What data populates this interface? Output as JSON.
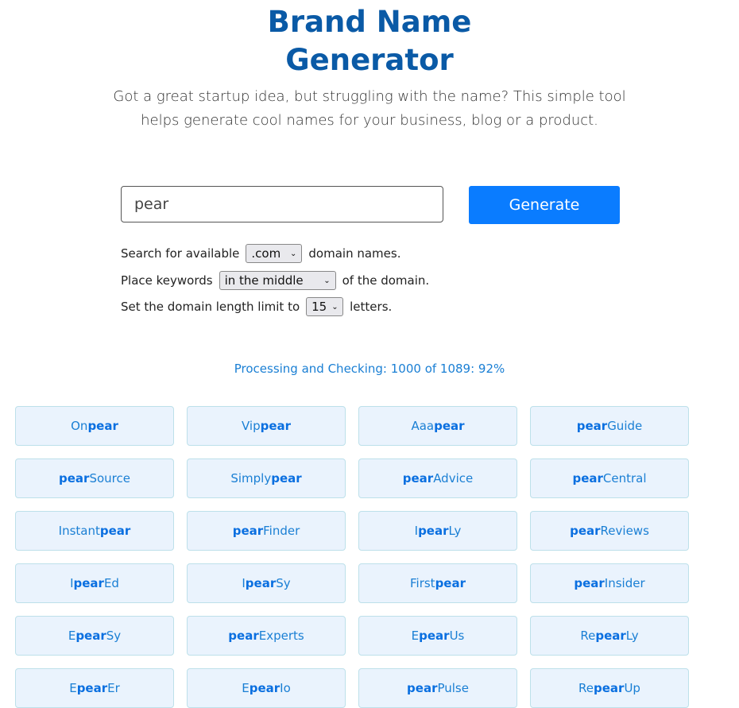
{
  "header": {
    "title_line1": "Brand Name",
    "title_line2": "Generator",
    "subtitle": "Got a great startup idea, but struggling with the name? This simple tool helps generate cool names for your business, blog or a product."
  },
  "form": {
    "keyword_value": "pear",
    "generate_label": "Generate",
    "tld_prefix": "Search for available",
    "tld_value": ".com",
    "tld_suffix": "domain names.",
    "place_prefix": "Place keywords",
    "place_value": "in the middle",
    "place_suffix": "of the domain.",
    "length_prefix": "Set the domain length limit to",
    "length_value": "15",
    "length_suffix": "letters."
  },
  "progress": {
    "text": "Processing and Checking: 1000 of 1089: 92%",
    "processed": 1000,
    "total": 1089,
    "percent": 92
  },
  "keyword": "pear",
  "results": [
    {
      "pre": "On",
      "kw": "pear",
      "post": ""
    },
    {
      "pre": "Vip",
      "kw": "pear",
      "post": ""
    },
    {
      "pre": "Aaa",
      "kw": "pear",
      "post": ""
    },
    {
      "pre": "",
      "kw": "pear",
      "post": "Guide"
    },
    {
      "pre": "",
      "kw": "pear",
      "post": "Source"
    },
    {
      "pre": "Simply",
      "kw": "pear",
      "post": ""
    },
    {
      "pre": "",
      "kw": "pear",
      "post": "Advice"
    },
    {
      "pre": "",
      "kw": "pear",
      "post": "Central"
    },
    {
      "pre": "Instant",
      "kw": "pear",
      "post": ""
    },
    {
      "pre": "",
      "kw": "pear",
      "post": "Finder"
    },
    {
      "pre": "I",
      "kw": "pear",
      "post": "Ly"
    },
    {
      "pre": "",
      "kw": "pear",
      "post": "Reviews"
    },
    {
      "pre": "I",
      "kw": "pear",
      "post": "Ed"
    },
    {
      "pre": "I",
      "kw": "pear",
      "post": "Sy"
    },
    {
      "pre": "First",
      "kw": "pear",
      "post": ""
    },
    {
      "pre": "",
      "kw": "pear",
      "post": "Insider"
    },
    {
      "pre": "E",
      "kw": "pear",
      "post": "Sy"
    },
    {
      "pre": "",
      "kw": "pear",
      "post": "Experts"
    },
    {
      "pre": "E",
      "kw": "pear",
      "post": "Us"
    },
    {
      "pre": "Re",
      "kw": "pear",
      "post": "Ly"
    },
    {
      "pre": "E",
      "kw": "pear",
      "post": "Er"
    },
    {
      "pre": "E",
      "kw": "pear",
      "post": "Io"
    },
    {
      "pre": "",
      "kw": "pear",
      "post": "Pulse"
    },
    {
      "pre": "Re",
      "kw": "pear",
      "post": "Up"
    }
  ],
  "colors": {
    "title": "#0a5aa6",
    "accent": "#0a7cff",
    "card_bg": "#eaf3fd",
    "card_text": "#1a7fd4"
  }
}
